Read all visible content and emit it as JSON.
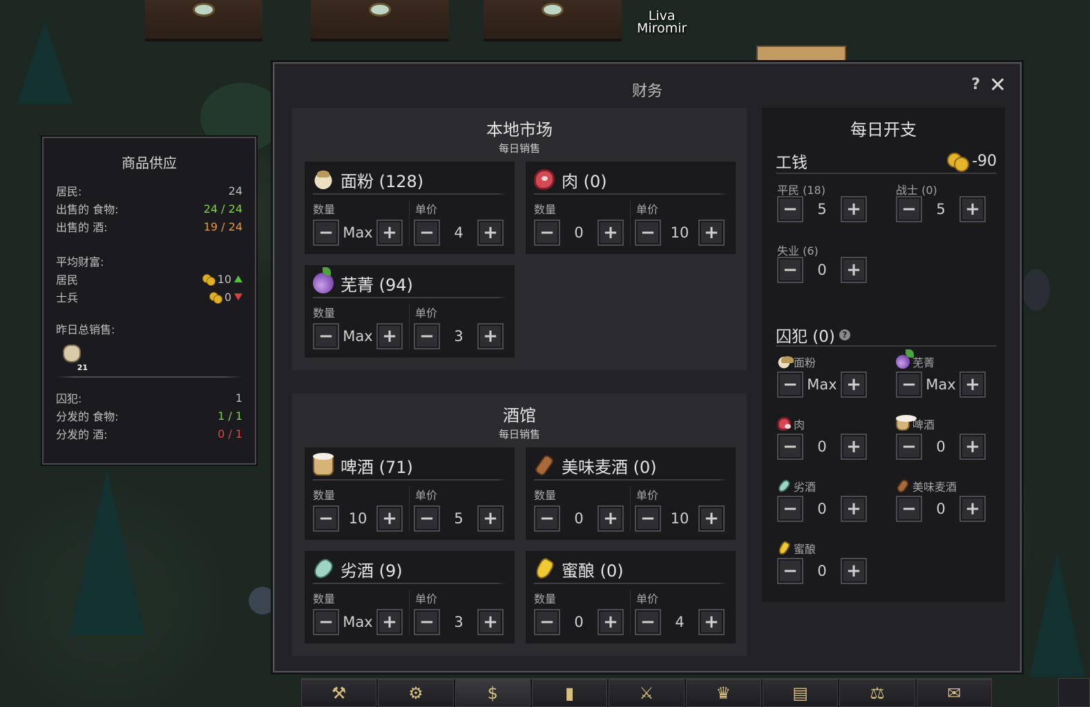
{
  "scene": {
    "npc_names": [
      "Liva",
      "Miromir"
    ]
  },
  "supply_panel": {
    "title": "商品供应",
    "rows": [
      {
        "label": "居民:",
        "value": "24",
        "tone": "normal"
      },
      {
        "label": "出售的 食物:",
        "value": "24 / 24",
        "tone": "green"
      },
      {
        "label": "出售的 酒:",
        "value": "19 / 24",
        "tone": "orange"
      }
    ],
    "wealth_title": "平均财富:",
    "wealth": [
      {
        "label": "居民",
        "value": "10",
        "trend": "up"
      },
      {
        "label": "士兵",
        "value": "0",
        "trend": "down"
      }
    ],
    "sales_title": "昨日总销售:",
    "sales_item": {
      "icon": "flour-sack-icon",
      "count": "21"
    },
    "prisoner_rows": [
      {
        "label": "囚犯:",
        "value": "1",
        "tone": "normal"
      },
      {
        "label": "分发的 食物:",
        "value": "1 / 1",
        "tone": "green"
      },
      {
        "label": "分发的 酒:",
        "value": "0 / 1",
        "tone": "red"
      }
    ]
  },
  "finance": {
    "title": "财务",
    "help": "?",
    "close": "✕",
    "labels": {
      "qty": "数量",
      "price": "单价"
    },
    "local_market": {
      "title": "本地市场",
      "subtitle": "每日销售",
      "items": [
        {
          "name": "面粉 (128)",
          "icon": "flour-icon",
          "qty": "Max",
          "price": "4"
        },
        {
          "name": "肉 (0)",
          "icon": "meat-icon",
          "qty": "0",
          "price": "10"
        },
        {
          "name": "芜菁 (94)",
          "icon": "turnip-icon",
          "qty": "Max",
          "price": "3"
        }
      ]
    },
    "tavern": {
      "title": "酒馆",
      "subtitle": "每日销售",
      "items": [
        {
          "name": "啤酒 (71)",
          "icon": "beer-icon",
          "qty": "10",
          "price": "5"
        },
        {
          "name": "美味麦酒 (0)",
          "icon": "ale-icon",
          "qty": "0",
          "price": "10"
        },
        {
          "name": "劣酒 (9)",
          "icon": "grog-icon",
          "qty": "Max",
          "price": "3"
        },
        {
          "name": "蜜酿 (0)",
          "icon": "mead-icon",
          "qty": "0",
          "price": "4"
        }
      ]
    },
    "expenses": {
      "title": "每日开支",
      "wages": {
        "title": "工钱",
        "total": "-90",
        "groups": [
          {
            "label": "平民 (18)",
            "value": "5"
          },
          {
            "label": "战士 (0)",
            "value": "5"
          },
          {
            "label": "失业 (6)",
            "value": "0"
          }
        ]
      },
      "prisoners": {
        "title": "囚犯 (0)",
        "help": "?",
        "items": [
          {
            "label": "面粉",
            "icon": "flour-icon",
            "value": "Max"
          },
          {
            "label": "芜菁",
            "icon": "turnip-icon",
            "value": "Max"
          },
          {
            "label": "肉",
            "icon": "meat-icon",
            "value": "0"
          },
          {
            "label": "啤酒",
            "icon": "beer-icon",
            "value": "0"
          },
          {
            "label": "劣酒",
            "icon": "grog-icon",
            "value": "0"
          },
          {
            "label": "美味麦酒",
            "icon": "ale-icon",
            "value": "0"
          },
          {
            "label": "蜜酿",
            "icon": "mead-icon",
            "value": "0"
          }
        ]
      }
    },
    "button_glyphs": {
      "minus": "−",
      "plus": "+"
    }
  },
  "toolbar": {
    "buttons": [
      {
        "name": "build-hammer-icon",
        "glyph": "⚒"
      },
      {
        "name": "settings-gear-icon",
        "glyph": "⚙"
      },
      {
        "name": "finance-moneybag-icon",
        "glyph": "$"
      },
      {
        "name": "statistics-chart-icon",
        "glyph": "▮"
      },
      {
        "name": "military-swords-icon",
        "glyph": "⚔"
      },
      {
        "name": "crown-icon",
        "glyph": "♛"
      },
      {
        "name": "book-icon",
        "glyph": "▤"
      },
      {
        "name": "justice-scales-icon",
        "glyph": "⚖"
      },
      {
        "name": "map-scroll-icon",
        "glyph": "✉"
      }
    ],
    "active_index": 2
  },
  "colors": {
    "green": "#7fd245",
    "orange": "#e39a3a",
    "red": "#e04848"
  }
}
